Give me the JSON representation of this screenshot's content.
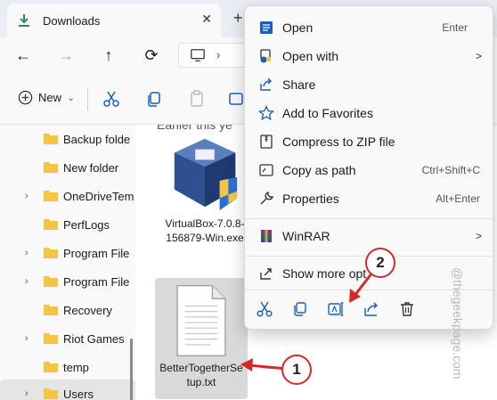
{
  "window": {
    "tab_title": "Downloads",
    "tab_close": "✕",
    "new_tab": "+"
  },
  "nav": {
    "back": "←",
    "forward": "→",
    "up": "↑",
    "refresh": "⟳"
  },
  "commandbar": {
    "new_label": "New",
    "new_chevron": "⌄"
  },
  "sidebar": {
    "items": [
      {
        "label": "Backup folde",
        "expandable": false
      },
      {
        "label": "New folder",
        "expandable": false
      },
      {
        "label": "OneDriveTem",
        "expandable": true
      },
      {
        "label": "PerfLogs",
        "expandable": false
      },
      {
        "label": "Program File",
        "expandable": true
      },
      {
        "label": "Program File",
        "expandable": true
      },
      {
        "label": "Recovery",
        "expandable": false
      },
      {
        "label": "Riot Games",
        "expandable": true
      },
      {
        "label": "temp",
        "expandable": false
      },
      {
        "label": "Users",
        "expandable": true
      }
    ]
  },
  "content": {
    "group_header": "Earlier this ye",
    "files": [
      {
        "name_line1": "VirtualBox-7.0.8-",
        "name_line2": "156879-Win.exe",
        "icon": "virtualbox-installer-icon"
      },
      {
        "name_line1": "BetterTogetherSe",
        "name_line2": "tup.txt",
        "icon": "text-file-icon"
      }
    ]
  },
  "context_menu": {
    "items": [
      {
        "label": "Open",
        "shortcut": "Enter",
        "icon": "open-icon"
      },
      {
        "label": "Open with",
        "shortcut": "",
        "icon": "open-with-icon",
        "submenu": true
      },
      {
        "label": "Share",
        "shortcut": "",
        "icon": "share-icon"
      },
      {
        "label": "Add to Favorites",
        "shortcut": "",
        "icon": "star-icon"
      },
      {
        "label": "Compress to ZIP file",
        "shortcut": "",
        "icon": "zip-icon"
      },
      {
        "label": "Copy as path",
        "shortcut": "Ctrl+Shift+C",
        "icon": "copy-path-icon"
      },
      {
        "label": "Properties",
        "shortcut": "Alt+Enter",
        "icon": "wrench-icon"
      },
      {
        "label": "WinRAR",
        "shortcut": "",
        "icon": "winrar-icon",
        "submenu": true
      },
      {
        "label": "Show more opt",
        "shortcut": "",
        "icon": "show-more-icon"
      }
    ],
    "submenu_arrow": ">",
    "bottom_actions": [
      "cut-icon",
      "copy-icon",
      "rename-icon",
      "share-icon",
      "delete-icon"
    ]
  },
  "annotations": {
    "callout_1": "1",
    "callout_2": "2",
    "accent_color": "#d62828"
  },
  "watermark": "@thegeekpage.com",
  "colors": {
    "folder": "#f4c542",
    "accent_blue": "#1a5fb4",
    "selected_bg": "#d9d9d9"
  }
}
